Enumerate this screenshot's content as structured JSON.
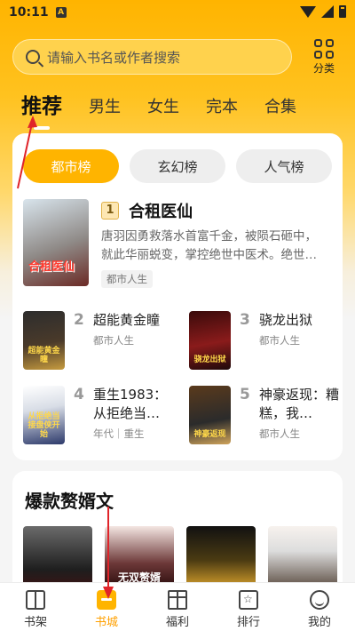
{
  "status_bar": {
    "time": "10:11",
    "notif_glyph": "A"
  },
  "search": {
    "placeholder": "请输入书名或作者搜索"
  },
  "category": {
    "label": "分类"
  },
  "tabs": [
    {
      "label": "推荐",
      "active": true
    },
    {
      "label": "男生"
    },
    {
      "label": "女生"
    },
    {
      "label": "完本"
    },
    {
      "label": "合集"
    }
  ],
  "ranking": {
    "subtabs": [
      {
        "label": "都市榜",
        "active": true
      },
      {
        "label": "玄幻榜"
      },
      {
        "label": "人气榜"
      }
    ],
    "featured": {
      "rank": "1",
      "title": "合租医仙",
      "cover_text": "合租医仙",
      "description": "唐羽因勇救落水首富千金，被陨石砸中，就此华丽蜕变，掌控绝世中医术。绝世…",
      "tag": "都市人生"
    },
    "items": [
      {
        "rank": "2",
        "title": "超能黄金瞳",
        "genre": "都市人生",
        "cover_text": "超能黄金瞳"
      },
      {
        "rank": "3",
        "title": "骁龙出狱",
        "genre": "都市人生",
        "cover_text": "骁龙出狱"
      },
      {
        "rank": "4",
        "title": "重生1983：从拒绝当…",
        "genre": "年代｜重生",
        "cover_text": "从拒绝当接盘侠开始"
      },
      {
        "rank": "5",
        "title": "神豪返现：糟糕，我…",
        "genre": "都市人生",
        "cover_text": "神豪返现"
      }
    ]
  },
  "section2": {
    "heading": "爆款赘婿文",
    "covers": [
      "",
      "无双赘婿",
      "",
      ""
    ]
  },
  "bottom_nav": [
    {
      "label": "书架",
      "icon": "bookshelf-icon"
    },
    {
      "label": "书城",
      "icon": "bookstore-icon",
      "active": true
    },
    {
      "label": "福利",
      "icon": "gift-icon"
    },
    {
      "label": "排行",
      "icon": "ranking-icon"
    },
    {
      "label": "我的",
      "icon": "profile-icon"
    }
  ],
  "colors": {
    "accent": "#ffb400",
    "active_nav": "#ffa000",
    "annotation": "#e0242a"
  }
}
